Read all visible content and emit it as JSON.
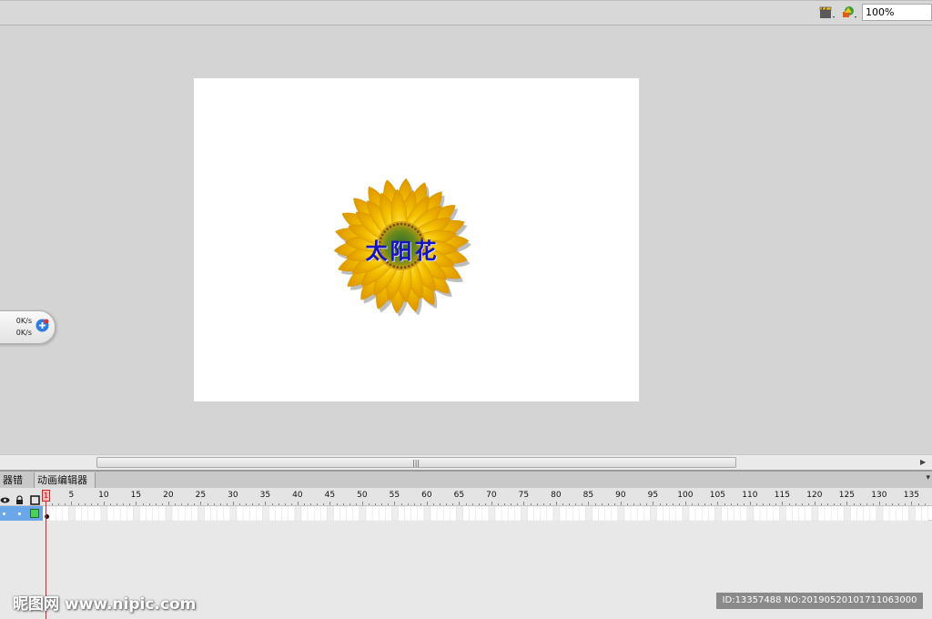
{
  "toolbar": {
    "zoom": "100%",
    "scene_icon": "clapperboard-icon",
    "symbol_icon": "edit-symbols-icon"
  },
  "stage": {
    "text": "太阳花",
    "flower": "sunflower-image"
  },
  "speed": {
    "up": "0K/s",
    "down": "0K/s"
  },
  "panel": {
    "tabs": [
      "器错误",
      "动画编辑器"
    ]
  },
  "timeline": {
    "playhead_frame": "1",
    "ticks": [
      "5",
      "10",
      "15",
      "20",
      "25",
      "30",
      "35",
      "40",
      "45",
      "50",
      "55",
      "60",
      "65",
      "70",
      "75",
      "80",
      "85",
      "90",
      "95",
      "100",
      "105",
      "110",
      "115",
      "120",
      "125",
      "130",
      "135"
    ]
  },
  "watermark": {
    "left": "昵图网 www.nipic.com",
    "right": "ID:13357488 NO:20190520101711063000"
  },
  "colors": {
    "stage_bg": "#ffffff",
    "workspace_bg": "#d4d4d4",
    "text_blue": "#1414b8",
    "petal_yellow": "#f5c400",
    "playhead_red": "#e02020",
    "layer_selected": "#6aa7e8"
  }
}
